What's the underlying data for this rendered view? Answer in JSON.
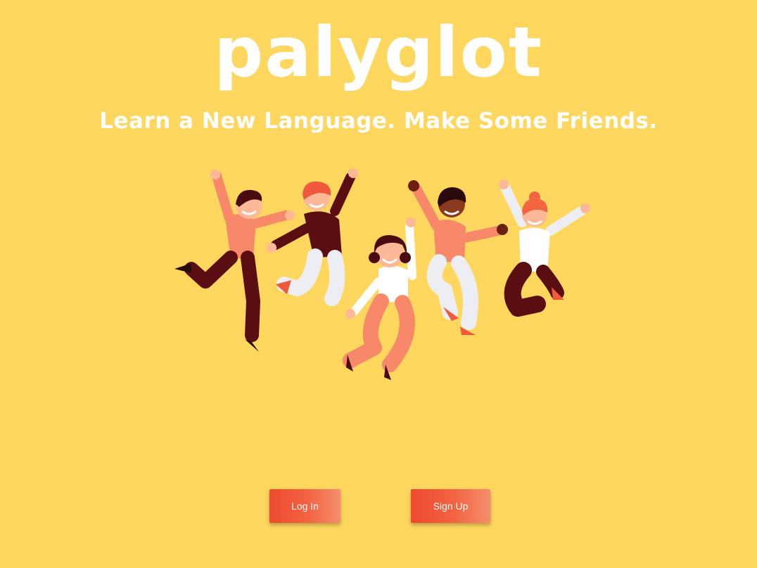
{
  "app": {
    "logo_text": "palyglot",
    "tagline": "Learn a New Language. Make Some Friends."
  },
  "hero": {
    "illustration": "five-people-jumping"
  },
  "actions": {
    "login_label": "Log In",
    "signup_label": "Sign Up"
  },
  "colors": {
    "background": "#FFD75E",
    "accent": "#F05A3C",
    "text": "#FFFFFF"
  }
}
